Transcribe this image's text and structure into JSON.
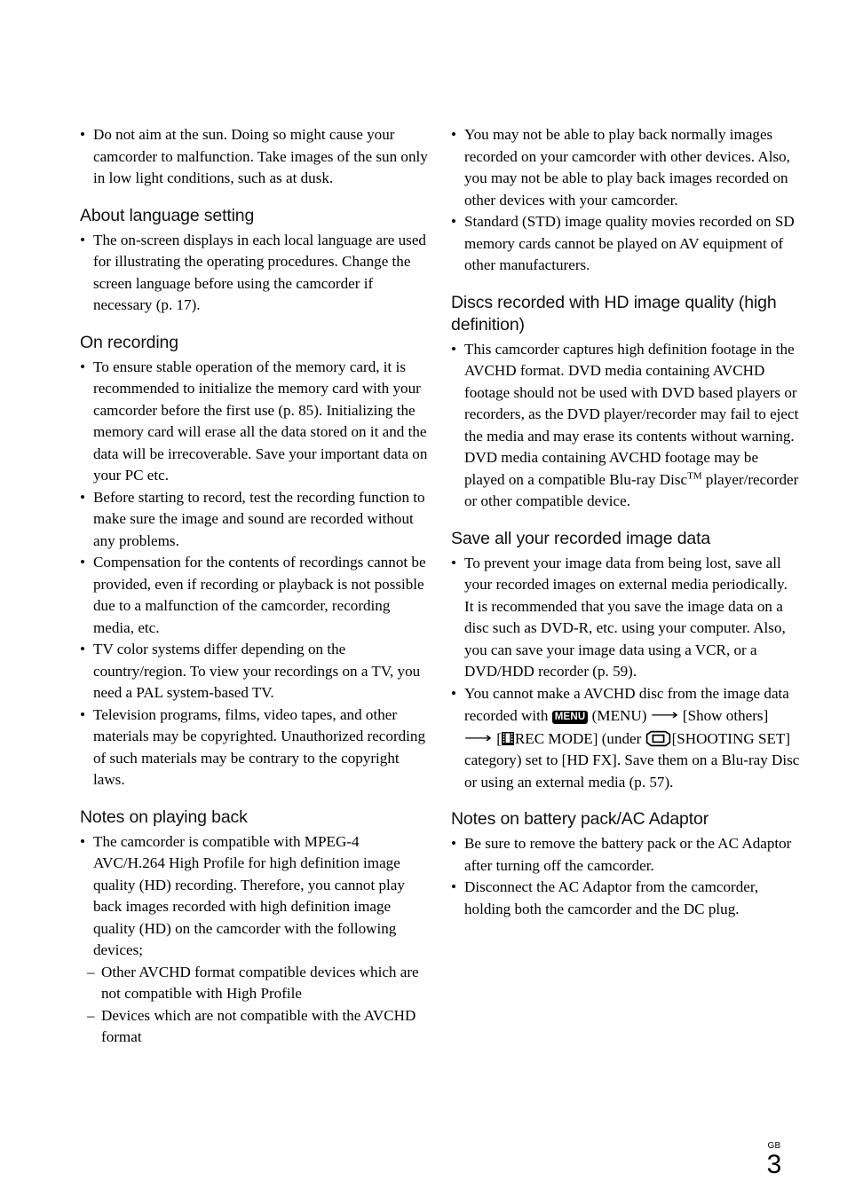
{
  "page": {
    "locale_code": "GB",
    "page_number": "3"
  },
  "left_column": {
    "intro_bullets": [
      "Do not aim at the sun. Doing so might cause your camcorder to malfunction. Take images of the sun only in low light conditions, such as at dusk."
    ],
    "sections": [
      {
        "heading": "About language setting",
        "bullets": [
          "The on-screen displays in each local language are used for illustrating the operating procedures. Change the screen language before using the camcorder if necessary (p. 17)."
        ]
      },
      {
        "heading": "On recording",
        "bullets": [
          "To ensure stable operation of the memory card, it is recommended to initialize the memory card with your camcorder before the first use (p. 85). Initializing the memory card will erase all the data stored on it and the data will be irrecoverable. Save your important data on your PC etc.",
          "Before starting to record, test the recording function to make sure the image and sound are recorded without any problems.",
          "Compensation for the contents of recordings cannot be provided, even if recording or playback is not possible due to a malfunction of the camcorder, recording media, etc.",
          "TV color systems differ depending on the country/region. To view your recordings on a TV, you need a PAL system-based TV.",
          "Television programs, films, video tapes, and other materials may be copyrighted. Unauthorized recording of such materials may be contrary to the copyright laws."
        ]
      },
      {
        "heading": "Notes on playing back",
        "bullets": [
          "The camcorder is compatible with MPEG-4 AVC/H.264 High Profile for high definition image quality (HD) recording. Therefore, you cannot play back images recorded with high definition image quality (HD) on the camcorder with the following devices;"
        ],
        "sub_items": [
          "Other AVCHD format compatible devices which are not compatible with High Profile",
          "Devices which are not compatible with the AVCHD format"
        ]
      }
    ]
  },
  "right_column": {
    "intro_bullets": [
      "You may not be able to play back normally images recorded on your camcorder with other devices. Also, you may not be able to  play back images recorded on other devices with your camcorder.",
      "Standard (STD) image quality movies recorded on SD memory cards cannot be played on AV equipment of other manufacturers."
    ],
    "sections": [
      {
        "heading": "Discs recorded with HD image quality (high definition)",
        "bullets_pre_tm": "This camcorder captures high definition footage in the AVCHD format. DVD media containing AVCHD footage should not be used with DVD based players or recorders, as the DVD player/recorder may fail to eject the media and may erase its contents without warning. DVD media containing AVCHD footage may be played on a compatible Blu-ray Disc",
        "tm_mark": "TM",
        "bullets_post_tm": " player/recorder or other compatible device."
      },
      {
        "heading": "Save all your recorded image data",
        "bullets": [
          "To prevent your image data from being lost, save all your recorded images on external media periodically. It is recommended that you save the image data on a disc such as DVD-R, etc. using your computer. Also, you can save your image data using a VCR, or a DVD/HDD recorder (p. 59)."
        ],
        "icon_bullet": {
          "seg1": "You cannot make a AVCHD disc from the image data recorded with ",
          "menu_badge_label": "MENU",
          "seg2": " (MENU) ",
          "arrow": "⟶",
          "seg3": " [Show others] ",
          "seg4": " [",
          "film_icon_name": "film-strip-icon",
          "seg5": "REC MODE] (under ",
          "shooting_icon_name": "camcorder-shooting-icon",
          "seg6": "[SHOOTING SET] category)  set to [HD FX]. Save them on a Blu-ray Disc or using an external media (p. 57)."
        }
      },
      {
        "heading": "Notes on battery pack/AC Adaptor",
        "bullets": [
          "Be sure to remove the battery pack or the AC Adaptor after turning off the camcorder.",
          "Disconnect the AC Adaptor from the camcorder, holding both the camcorder and the DC plug."
        ]
      }
    ]
  }
}
